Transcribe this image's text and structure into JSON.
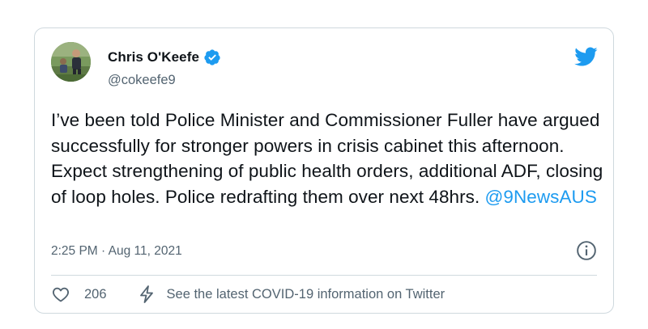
{
  "author": {
    "display_name": "Chris O'Keefe",
    "handle": "@cokeefe9",
    "verified": true
  },
  "tweet": {
    "text": "I’ve been told Police Minister and Commissioner Fuller have argued successfully for stronger powers in crisis cabinet this afternoon. Expect strengthening of public health orders, additional ADF, closing of loop holes. Police redrafting them over next 48hrs. ",
    "mention": "@9NewsAUS",
    "timestamp": "2:25 PM · Aug 11, 2021"
  },
  "footer": {
    "like_count": "206",
    "covid_link": "See the latest COVID-19 information on Twitter"
  },
  "icons": {
    "brand": "twitter-bird-icon",
    "verified": "verified-badge-icon",
    "info": "info-icon",
    "like": "heart-icon",
    "covid": "lightning-bolt-icon"
  },
  "colors": {
    "accent": "#1d9bf0",
    "text": "#0f1419",
    "secondary": "#536471",
    "border": "#cfd9de"
  }
}
